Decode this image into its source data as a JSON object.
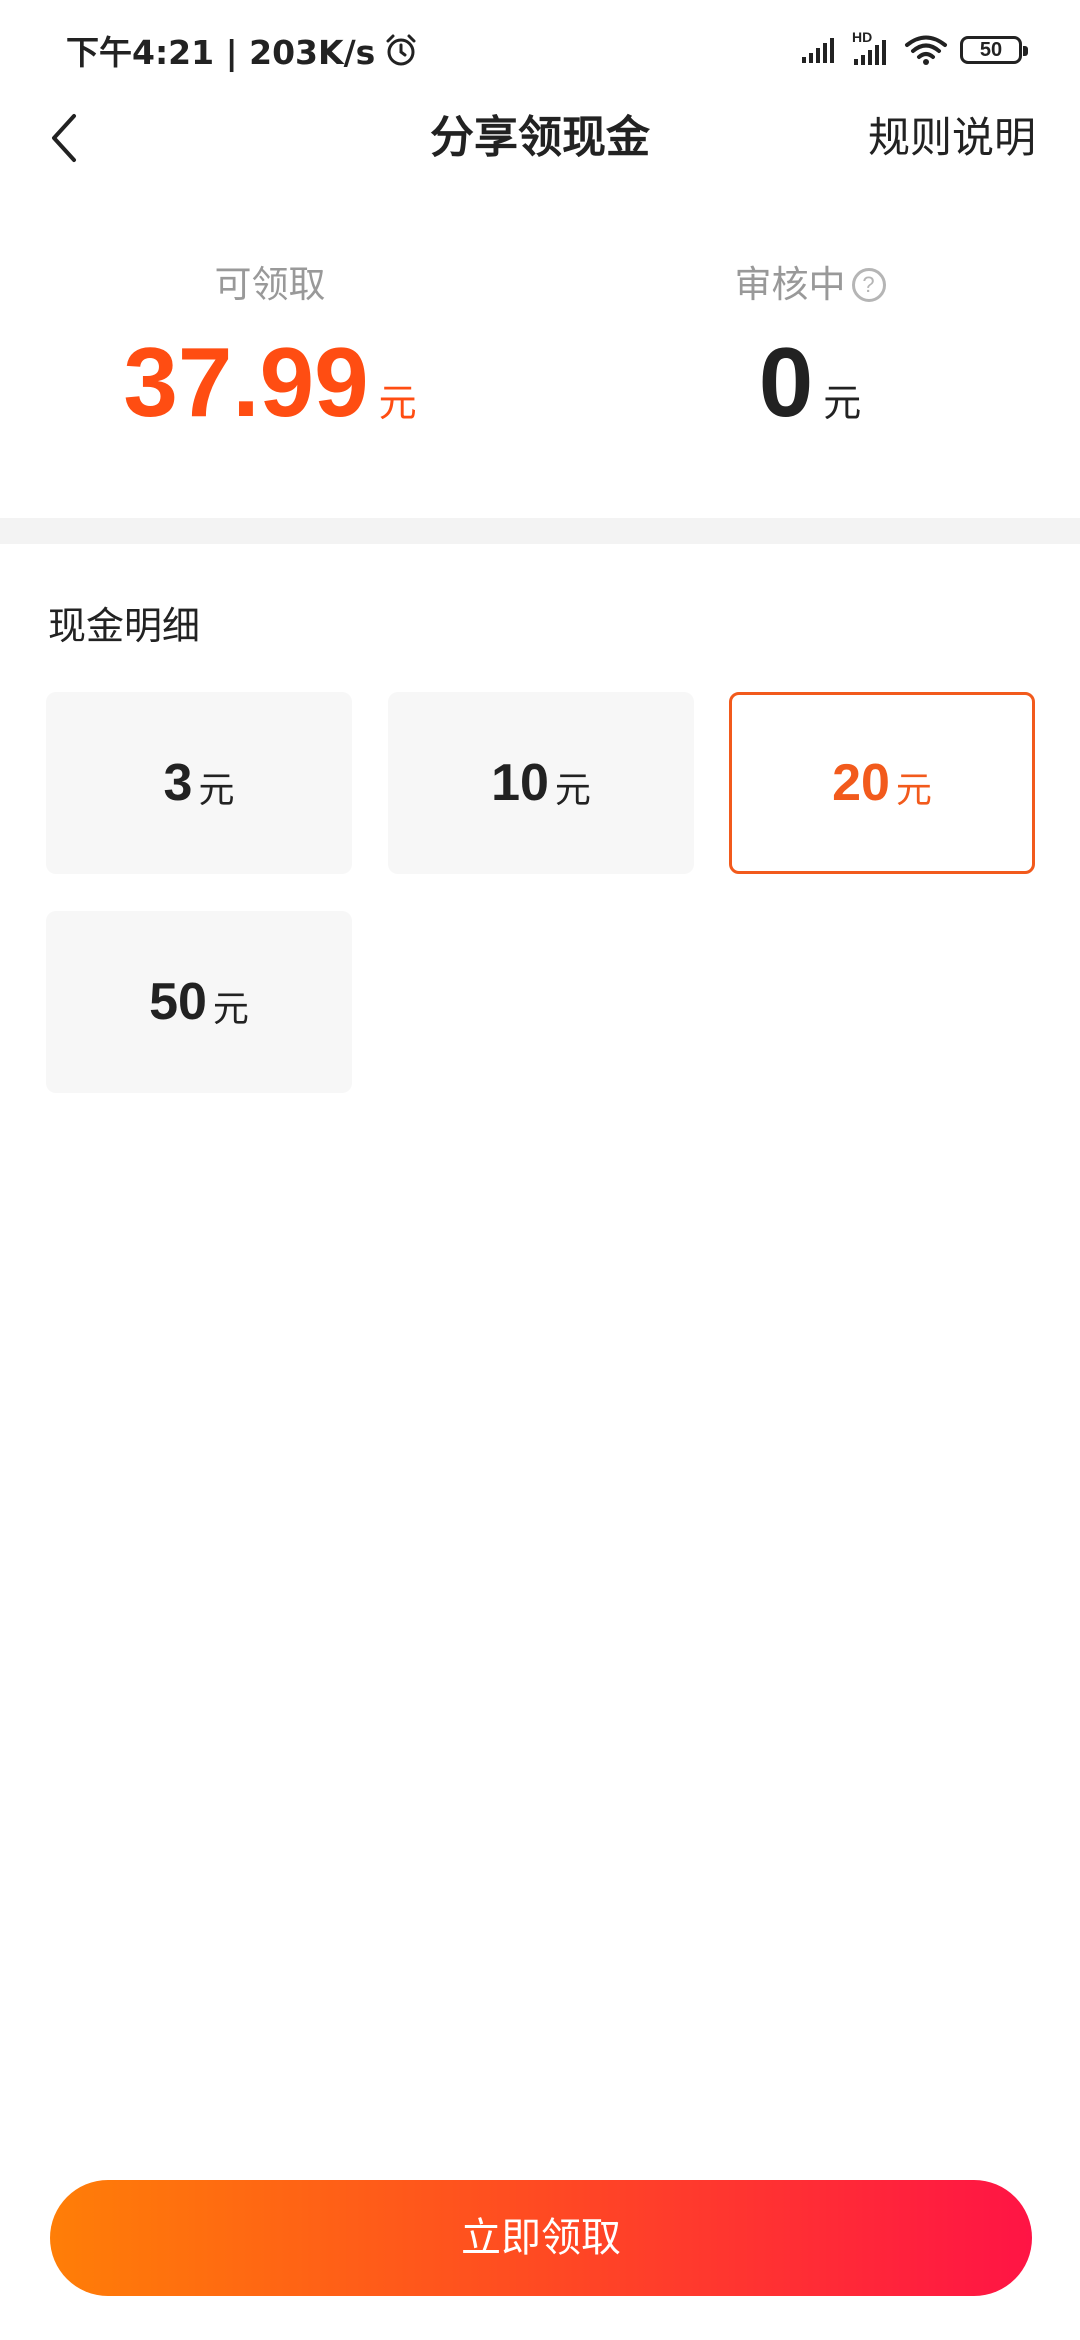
{
  "status_bar": {
    "time_speed": "下午4:21 | 203K/s",
    "hd_label": "HD",
    "battery": "50",
    "icons": [
      "alarm-icon",
      "signal-icon",
      "signal-hd-icon",
      "wifi-icon",
      "battery-icon"
    ]
  },
  "header": {
    "title": "分享领现金",
    "rules_label": "规则说明",
    "back_icon": "chevron-left-icon"
  },
  "balances": {
    "available": {
      "label": "可领取",
      "amount": "37.99",
      "unit": "元"
    },
    "reviewing": {
      "label": "审核中",
      "help_icon": "?",
      "amount": "0",
      "unit": "元"
    }
  },
  "cash_detail": {
    "title": "现金明细",
    "options": [
      {
        "amount": "3",
        "unit": "元",
        "selected": false
      },
      {
        "amount": "10",
        "unit": "元",
        "selected": false
      },
      {
        "amount": "20",
        "unit": "元",
        "selected": true
      },
      {
        "amount": "50",
        "unit": "元",
        "selected": false
      }
    ]
  },
  "claim_button": {
    "label": "立即领取"
  },
  "colors": {
    "accent_orange": "#ff4d12",
    "selected_border": "#f25a1c",
    "button_gradient_start": "#ff7e07",
    "button_gradient_end": "#ff1445"
  }
}
